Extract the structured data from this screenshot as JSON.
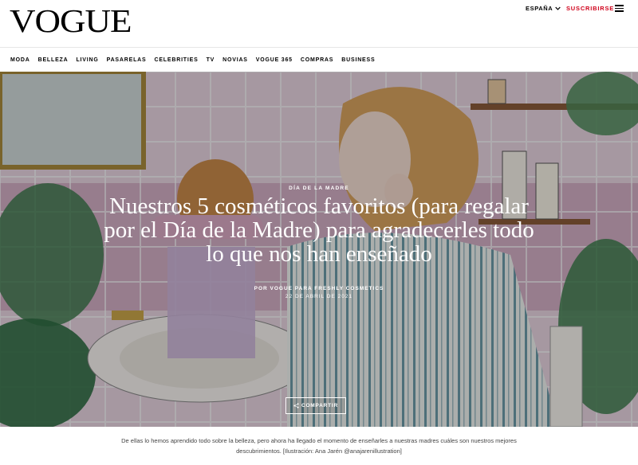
{
  "header": {
    "logo": "VOGUE",
    "region": "ESPAÑA",
    "subscribe": "SUSCRIBIRSE"
  },
  "nav": {
    "items": [
      "MODA",
      "BELLEZA",
      "LIVING",
      "PASARELAS",
      "CELEBRITIES",
      "TV",
      "NOVIAS",
      "VOGUE 365",
      "COMPRAS",
      "BUSINESS"
    ]
  },
  "article": {
    "kicker": "DÍA DE LA MADRE",
    "headline": "Nuestros 5 cosméticos favoritos (para regalar por el Día de la Madre) para agradecerles todo lo que nos han enseñado",
    "byline": "POR VOGUE PARA FRESHLY COSMETICS",
    "date": "22 DE ABRIL DE 2021",
    "share_label": "COMPARTIR",
    "description": "De ellas lo hemos aprendido todo sobre la belleza, pero ahora ha llegado el momento de enseñarles a nuestras madres cuáles son nuestros mejores descubrimientos. [Ilustración: Ana Jarén @anajarenillustration]"
  },
  "colors": {
    "accent_red": "#d0021b",
    "tile_pink": "#d9b3c6",
    "hair": "#c8894a",
    "stripe": "#5b8fa0"
  }
}
